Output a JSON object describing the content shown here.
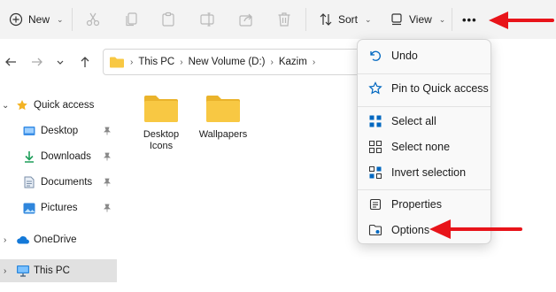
{
  "toolbar": {
    "new_label": "New",
    "sort_label": "Sort",
    "view_label": "View",
    "more_label": "•••",
    "icons": [
      "new-plus-icon",
      "cut-icon",
      "copy-icon",
      "paste-icon",
      "rename-icon",
      "share-icon",
      "delete-icon",
      "sort-icon",
      "view-icon",
      "more-icon"
    ]
  },
  "nav": {
    "breadcrumbs": [
      "This PC",
      "New Volume (D:)",
      "Kazim"
    ]
  },
  "sidebar": {
    "items": [
      {
        "label": "Quick access",
        "icon": "star-icon"
      },
      {
        "label": "Desktop",
        "icon": "desktop-folder-icon",
        "pinned": true
      },
      {
        "label": "Downloads",
        "icon": "download-icon",
        "pinned": true
      },
      {
        "label": "Documents",
        "icon": "documents-icon",
        "pinned": true
      },
      {
        "label": "Pictures",
        "icon": "pictures-icon",
        "pinned": true
      },
      {
        "label": "OneDrive",
        "icon": "onedrive-cloud-icon"
      },
      {
        "label": "This PC",
        "icon": "computer-icon",
        "selected": true
      }
    ]
  },
  "content": {
    "folders": [
      {
        "name": "Desktop Icons"
      },
      {
        "name": "Wallpapers"
      }
    ]
  },
  "menu": {
    "items": [
      {
        "label": "Undo",
        "icon": "undo-icon"
      },
      {
        "label": "Pin to Quick access",
        "icon": "pin-icon"
      },
      {
        "label": "Select all",
        "icon": "select-all-icon"
      },
      {
        "label": "Select none",
        "icon": "select-none-icon"
      },
      {
        "label": "Invert selection",
        "icon": "invert-selection-icon"
      },
      {
        "label": "Properties",
        "icon": "properties-icon"
      },
      {
        "label": "Options",
        "icon": "options-icon"
      }
    ]
  },
  "colors": {
    "accent": "#0067c0",
    "folder_yellow": "#f8c843",
    "annotation_red": "#e8141a"
  }
}
